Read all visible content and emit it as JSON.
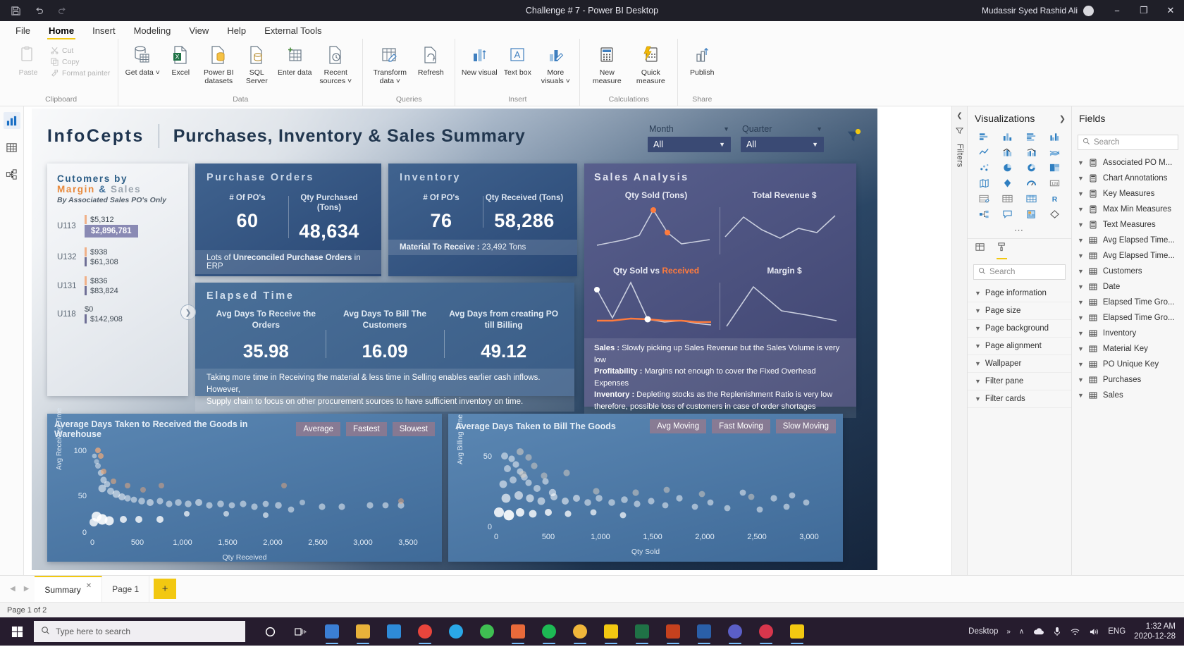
{
  "titlebar": {
    "title": "Challenge # 7 - Power BI Desktop",
    "user": "Mudassir Syed Rashid Ali",
    "save_icon": "save-icon",
    "undo_icon": "undo-icon",
    "redo_icon": "redo-icon",
    "minimize": "−",
    "maximize": "❐",
    "close": "✕"
  },
  "ribbon": {
    "tabs": [
      "File",
      "Home",
      "Insert",
      "Modeling",
      "View",
      "Help",
      "External Tools"
    ],
    "active_tab": "Home",
    "groups": [
      {
        "label": "Clipboard",
        "paste": "Paste",
        "items": [
          "Cut",
          "Copy",
          "Format painter"
        ]
      },
      {
        "label": "Data",
        "items": [
          "Get data ˅",
          "Excel",
          "Power BI datasets",
          "SQL Server",
          "Enter data",
          "Recent sources ˅"
        ]
      },
      {
        "label": "Queries",
        "items": [
          "Transform data ˅",
          "Refresh"
        ]
      },
      {
        "label": "Insert",
        "items": [
          "New visual",
          "Text box",
          "More visuals ˅"
        ]
      },
      {
        "label": "Calculations",
        "items": [
          "New measure",
          "Quick measure"
        ]
      },
      {
        "label": "Share",
        "items": [
          "Publish"
        ]
      }
    ]
  },
  "leftrail": [
    {
      "name": "report-view-icon",
      "active": true
    },
    {
      "name": "data-view-icon",
      "active": false
    },
    {
      "name": "model-view-icon",
      "active": false
    }
  ],
  "report": {
    "brand": "InfoCepts",
    "title": "Purchases, Inventory & Sales Summary",
    "slicers": [
      {
        "label": "Month",
        "value": "All"
      },
      {
        "label": "Quarter",
        "value": "All"
      }
    ],
    "customers": {
      "title_line1": "Cutomers by",
      "title_line2_margin": "Margin",
      "title_line2_amp": "&",
      "title_line2_sales": "Sales",
      "subtitle": "By Associated  Sales PO's Only",
      "rows": [
        {
          "label": "U113",
          "margin": "$5,312",
          "sales": "$2,896,781",
          "highlight": true
        },
        {
          "label": "U132",
          "margin": "$938",
          "sales": "$61,308",
          "highlight": false
        },
        {
          "label": "U131",
          "margin": "$836",
          "sales": "$83,824",
          "highlight": false
        },
        {
          "label": "U118",
          "margin": "$0",
          "sales": "$142,908",
          "highlight": false
        }
      ],
      "next_icon": "chevron-right-icon"
    },
    "purchase_orders": {
      "header": "Purchase Orders",
      "kpis": [
        {
          "label": "# Of PO's",
          "value": "60"
        },
        {
          "label": "Qty Purchased (Tons)",
          "value": "48,634"
        }
      ],
      "footer_pre": "Lots of ",
      "footer_bold": "Unreconciled  Purchase Orders",
      "footer_post": " in ERP"
    },
    "inventory": {
      "header": "Inventory",
      "kpis": [
        {
          "label": "# Of PO's",
          "value": "76"
        },
        {
          "label": "Qty Received (Tons)",
          "value": "58,286"
        }
      ],
      "footer_bold": "Material To Receive :",
      "footer_post": " 23,492 Tons"
    },
    "elapsed_time": {
      "header": "Elapsed Time",
      "kpis": [
        {
          "label": "Avg Days  To Receive the Orders",
          "value": "35.98"
        },
        {
          "label": "Avg Days To Bill The Customers",
          "value": "16.09"
        },
        {
          "label": "Avg Days from creating PO till Billing",
          "value": "49.12"
        }
      ],
      "footer_line1": "Taking more time in Receiving the material & less time in Selling enables earlier cash inflows. However,",
      "footer_line2": "Supply chain to focus on other procurement sources to have sufficient inventory on time."
    },
    "sales_analysis": {
      "header": "Sales Analysis",
      "charts": [
        {
          "label": "Qty Sold (Tons)",
          "label_hl": ""
        },
        {
          "label": "Total Revenue $",
          "label_hl": ""
        },
        {
          "label_pre": "Qty Sold vs ",
          "label_hl": "Received"
        },
        {
          "label": "Margin $",
          "label_hl": ""
        }
      ],
      "notes": [
        {
          "bold": "Sales :",
          "text": " Slowly picking up Sales Revenue but the Sales Volume is very low"
        },
        {
          "bold": "Profitability :",
          "text": " Margins not enough to cover the Fixed Overhead Expenses"
        },
        {
          "bold": "Inventory :",
          "text": "  Depleting stocks as the Replenishment Ratio is very low"
        },
        {
          "bold": "",
          "text": "therefore, possible loss of customers in case of order shortages"
        }
      ]
    },
    "scatter_left": {
      "title": "Average Days Taken to Received the Goods in Warehouse",
      "buttons": [
        "Average",
        "Fastest",
        "Slowest"
      ],
      "ylabel": "Avg Receiving Time",
      "xlabel": "Qty Received",
      "yticks": [
        "100",
        "50",
        "0"
      ],
      "xticks": [
        "0",
        "500",
        "1,000",
        "1,500",
        "2,000",
        "2,500",
        "3,000",
        "3,500"
      ]
    },
    "scatter_right": {
      "title": "Average Days Taken to Bill The Goods",
      "buttons": [
        "Avg Moving",
        "Fast Moving",
        "Slow Moving"
      ],
      "ylabel": "Avg Billing Time",
      "xlabel": "Qty Sold",
      "yticks": [
        "50",
        "0"
      ],
      "xticks": [
        "0",
        "500",
        "1,000",
        "1,500",
        "2,000",
        "2,500",
        "3,000"
      ]
    }
  },
  "chart_data": [
    {
      "type": "bar",
      "title": "Cutomers by Margin & Sales",
      "categories": [
        "U113",
        "U132",
        "U131",
        "U118"
      ],
      "series": [
        {
          "name": "Margin",
          "values": [
            5312,
            938,
            836,
            0
          ],
          "labels": [
            "$5,312",
            "$938",
            "$836",
            "$0"
          ]
        },
        {
          "name": "Sales",
          "values": [
            2896781,
            61308,
            83824,
            142908
          ],
          "labels": [
            "$2,896,781",
            "$61,308",
            "$83,824",
            "$142,908"
          ]
        }
      ],
      "xlabel": "",
      "ylabel": ""
    },
    {
      "type": "line",
      "title": "Qty Sold (Tons)",
      "x": [
        1,
        2,
        3,
        4,
        5,
        6,
        7,
        8
      ],
      "values": [
        18,
        22,
        26,
        30,
        86,
        34,
        20,
        24
      ],
      "grid": false,
      "legend": "none"
    },
    {
      "type": "line",
      "title": "Total Revenue $",
      "x": [
        1,
        2,
        3,
        4,
        5,
        6,
        7,
        8
      ],
      "values": [
        30,
        58,
        40,
        30,
        44,
        38,
        55,
        70
      ],
      "grid": false,
      "legend": "none"
    },
    {
      "type": "line",
      "title": "Qty Sold vs Received",
      "x": [
        1,
        2,
        3,
        4,
        5,
        6,
        7,
        8
      ],
      "series": [
        {
          "name": "Received",
          "values": [
            62,
            20,
            80,
            22,
            18,
            20,
            16,
            14
          ]
        },
        {
          "name": "Qty Sold",
          "values": [
            14,
            14,
            16,
            15,
            14,
            14,
            13,
            13
          ]
        }
      ],
      "grid": false,
      "legend": "none"
    },
    {
      "type": "line",
      "title": "Margin $",
      "x": [
        1,
        2,
        3,
        4,
        5
      ],
      "values": [
        12,
        72,
        40,
        34,
        30
      ],
      "grid": false,
      "legend": "none"
    },
    {
      "type": "scatter",
      "title": "Average Days Taken to Received the Goods in Warehouse",
      "xlabel": "Qty Received",
      "ylabel": "Avg Receiving Time",
      "xlim": [
        0,
        3750
      ],
      "ylim": [
        0,
        110
      ],
      "xticks": [
        0,
        500,
        1000,
        1500,
        2000,
        2500,
        3000,
        3500
      ],
      "yticks": [
        0,
        50,
        100
      ],
      "points": [
        [
          60,
          92
        ],
        [
          75,
          85
        ],
        [
          70,
          78
        ],
        [
          90,
          70
        ],
        [
          110,
          62
        ],
        [
          130,
          58
        ],
        [
          95,
          55
        ],
        [
          150,
          52
        ],
        [
          60,
          48
        ],
        [
          180,
          46
        ],
        [
          210,
          44
        ],
        [
          240,
          42
        ],
        [
          120,
          40
        ],
        [
          300,
          44
        ],
        [
          340,
          48
        ],
        [
          400,
          40
        ],
        [
          440,
          38
        ],
        [
          500,
          36
        ],
        [
          560,
          40
        ],
        [
          620,
          38
        ],
        [
          700,
          36
        ],
        [
          760,
          34
        ],
        [
          830,
          38
        ],
        [
          900,
          34
        ],
        [
          980,
          32
        ],
        [
          1060,
          36
        ],
        [
          1140,
          30
        ],
        [
          1220,
          34
        ],
        [
          1300,
          32
        ],
        [
          1400,
          30
        ],
        [
          1500,
          34
        ],
        [
          1600,
          28
        ],
        [
          1700,
          32
        ],
        [
          1820,
          30
        ],
        [
          1950,
          26
        ],
        [
          2100,
          33
        ],
        [
          2300,
          33
        ],
        [
          2620,
          33
        ],
        [
          2950,
          34
        ],
        [
          3120,
          34
        ],
        [
          3300,
          33
        ],
        [
          60,
          20
        ],
        [
          110,
          18
        ],
        [
          180,
          20
        ],
        [
          260,
          22
        ],
        [
          360,
          20
        ],
        [
          620,
          24
        ],
        [
          700,
          22
        ],
        [
          820,
          20
        ],
        [
          1180,
          26
        ],
        [
          1460,
          24
        ],
        [
          1760,
          22
        ],
        [
          2000,
          18
        ]
      ]
    },
    {
      "type": "scatter",
      "title": "Average Days Taken to Bill The Goods",
      "xlabel": "Qty Sold",
      "ylabel": "Avg Billing Time",
      "xlim": [
        0,
        3200
      ],
      "ylim": [
        0,
        58
      ],
      "xticks": [
        0,
        500,
        1000,
        1500,
        2000,
        2500,
        3000
      ],
      "yticks": [
        0,
        50
      ],
      "points": [
        [
          80,
          52
        ],
        [
          120,
          50
        ],
        [
          140,
          46
        ],
        [
          100,
          44
        ],
        [
          160,
          42
        ],
        [
          190,
          38
        ],
        [
          120,
          36
        ],
        [
          70,
          34
        ],
        [
          210,
          34
        ],
        [
          250,
          30
        ],
        [
          300,
          36
        ],
        [
          340,
          28
        ],
        [
          180,
          26
        ],
        [
          120,
          24
        ],
        [
          260,
          24
        ],
        [
          320,
          22
        ],
        [
          380,
          26
        ],
        [
          420,
          22
        ],
        [
          470,
          24
        ],
        [
          520,
          20
        ],
        [
          580,
          24
        ],
        [
          640,
          20
        ],
        [
          700,
          22
        ],
        [
          780,
          18
        ],
        [
          860,
          20
        ],
        [
          940,
          16
        ],
        [
          1020,
          22
        ],
        [
          1120,
          14
        ],
        [
          1220,
          18
        ],
        [
          1360,
          12
        ],
        [
          1500,
          22
        ],
        [
          1640,
          10
        ],
        [
          1800,
          16
        ],
        [
          1960,
          12
        ],
        [
          2120,
          18
        ],
        [
          2300,
          8
        ],
        [
          2480,
          14
        ],
        [
          2700,
          10
        ],
        [
          2880,
          6
        ],
        [
          90,
          10
        ],
        [
          160,
          8
        ],
        [
          240,
          10
        ],
        [
          330,
          6
        ],
        [
          430,
          8
        ],
        [
          560,
          6
        ],
        [
          700,
          8
        ],
        [
          900,
          6
        ],
        [
          1150,
          8
        ]
      ]
    }
  ],
  "visualizations": {
    "title": "Visualizations",
    "collapse_icon": "chevron-right-icon",
    "filters_label": "Filters",
    "format_tabs": [
      "paint-roller-icon",
      "format-icon"
    ],
    "search_placeholder": "Search",
    "more_icon": "ellipsis-icon",
    "format_sections": [
      "Page information",
      "Page size",
      "Page background",
      "Page alignment",
      "Wallpaper",
      "Filter pane",
      "Filter cards"
    ]
  },
  "fields": {
    "title": "Fields",
    "search_placeholder": "Search",
    "items": [
      {
        "label": "Associated PO M...",
        "icon": "measure-icon"
      },
      {
        "label": "Chart Annotations",
        "icon": "measure-icon"
      },
      {
        "label": "Key Measures",
        "icon": "measure-icon"
      },
      {
        "label": "Max Min Measures",
        "icon": "measure-icon"
      },
      {
        "label": "Text Measures",
        "icon": "measure-icon"
      },
      {
        "label": "Avg Elapsed Time...",
        "icon": "table-icon"
      },
      {
        "label": "Avg Elapsed Time...",
        "icon": "table-icon"
      },
      {
        "label": "Customers",
        "icon": "table-icon"
      },
      {
        "label": "Date",
        "icon": "table-icon"
      },
      {
        "label": "Elapsed Time Gro...",
        "icon": "table-icon"
      },
      {
        "label": "Elapsed Time Gro...",
        "icon": "table-icon"
      },
      {
        "label": "Inventory",
        "icon": "table-icon"
      },
      {
        "label": "Material Key",
        "icon": "table-icon"
      },
      {
        "label": "PO Unique Key",
        "icon": "table-icon"
      },
      {
        "label": "Purchases",
        "icon": "table-icon"
      },
      {
        "label": "Sales",
        "icon": "table-icon"
      }
    ]
  },
  "pagetabs": {
    "tabs": [
      {
        "label": "Summary",
        "active": true,
        "close": "✕"
      },
      {
        "label": "Page 1",
        "active": false
      }
    ],
    "add_label": "+",
    "status": "Page 1 of 2"
  },
  "taskbar": {
    "search_placeholder": "Type here to search",
    "start_icon": "windows-icon",
    "cortana_icon": "cortana-icon",
    "taskview_icon": "task-view-icon",
    "tray": {
      "desktop_label": "Desktop",
      "overflow_icon": "»",
      "chevron_icon": "∧",
      "cloud_icon": "onedrive-icon",
      "mic_icon": "microphone-icon",
      "wifi_icon": "wifi-icon",
      "volume_icon": "volume-icon",
      "language": "ENG",
      "time": "1:32 AM",
      "date": "2020-12-28"
    },
    "apps": [
      {
        "name": "file-explorer",
        "color": "#3b7fd4",
        "running": true
      },
      {
        "name": "folder",
        "color": "#e8b23a",
        "running": true
      },
      {
        "name": "mail",
        "color": "#2e8bd8",
        "running": false
      },
      {
        "name": "chrome",
        "color": "#e8453c",
        "running": true
      },
      {
        "name": "skype",
        "color": "#2aa8e8",
        "running": false
      },
      {
        "name": "whatsapp",
        "color": "#3fbf52",
        "running": false
      },
      {
        "name": "sublime",
        "color": "#e86a3a",
        "running": true
      },
      {
        "name": "spotify",
        "color": "#1db954",
        "running": true
      },
      {
        "name": "chrome-2",
        "color": "#f0b63a",
        "running": true
      },
      {
        "name": "powerbi",
        "color": "#f2c811",
        "running": true
      },
      {
        "name": "excel",
        "color": "#1f7246",
        "running": true
      },
      {
        "name": "powerpoint",
        "color": "#c5411e",
        "running": true
      },
      {
        "name": "outlook",
        "color": "#2a5fa8",
        "running": true
      },
      {
        "name": "teams",
        "color": "#5b5fc7",
        "running": true
      },
      {
        "name": "opera",
        "color": "#d8364c",
        "running": true
      },
      {
        "name": "powerbi-desktop",
        "color": "#f2c811",
        "running": true
      }
    ]
  },
  "colors": {
    "accent_yellow": "#f2c811",
    "brand_blue": "#2b5d86",
    "margin_orange": "#e8893b",
    "highlight_purple": "#8a8ab4"
  }
}
